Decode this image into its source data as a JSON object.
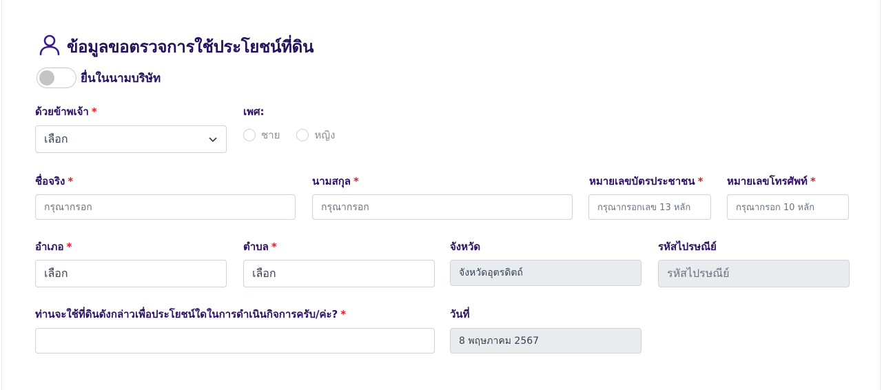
{
  "header": {
    "title": "ข้อมูลขอตรวจการใช้ประโยชน์ที่ดิน",
    "icon": "user-icon"
  },
  "company_toggle": {
    "label": "ยื่นในนามบริษัท",
    "checked": false
  },
  "form": {
    "prefix": {
      "label": "ด้วยข้าพเจ้า",
      "required": "*",
      "value": "เลือก"
    },
    "gender": {
      "label": "เพศ:",
      "options": [
        "ชาย",
        "หญิง"
      ]
    },
    "first_name": {
      "label": "ชื่อจริง",
      "required": "*",
      "placeholder": "กรุณากรอก"
    },
    "last_name": {
      "label": "นามสกุล",
      "required": "*",
      "placeholder": "กรุณากรอก"
    },
    "id_card": {
      "label": "หมายเลขบัตรประชาชน",
      "required": "*",
      "placeholder": "กรุณากรอกเลข 13 หลัก"
    },
    "phone": {
      "label": "หมายเลขโทรศัพท์",
      "required": "*",
      "placeholder": "กรุณากรอก 10 หลัก"
    },
    "district": {
      "label": "อำเภอ",
      "required": "*",
      "value": "เลือก"
    },
    "subdistrict": {
      "label": "ตำบล",
      "required": "*",
      "value": "เลือก"
    },
    "province": {
      "label": "จังหวัด",
      "value": "จังหวัดอุตรดิตถ์"
    },
    "postal_code": {
      "label": "รหัสไปรษณีย์",
      "placeholder": "รหัสไปรษณีย์"
    },
    "purpose": {
      "label": "ท่านจะใช้ที่ดินดังกล่าวเพื่อประโยชน์ใดในการดำเนินกิจการครับ/ค่ะ?",
      "required": "*",
      "value": ""
    },
    "date": {
      "label": "วันที่",
      "value": "8 พฤษภาคม 2567"
    }
  },
  "colors": {
    "title": "#24105c",
    "label": "#2e1065",
    "required": "#e11d2b",
    "disabled_bg": "#e9ecef"
  }
}
